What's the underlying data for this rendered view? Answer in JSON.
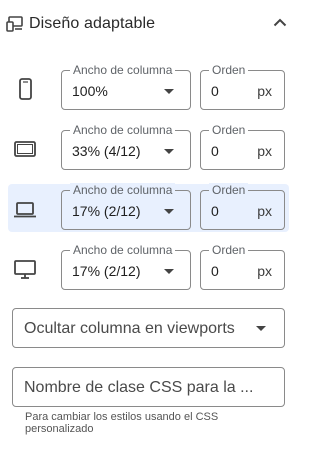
{
  "section": {
    "title": "Diseño adaptable",
    "icon": "responsive-devices-icon",
    "collapse_icon": "chevron-up-icon"
  },
  "rows": [
    {
      "device": "mobile",
      "icon": "mobile-icon",
      "column_label": "Ancho de columna",
      "column_value": "100%",
      "order_label": "Orden",
      "order_value": "0",
      "order_unit": "px",
      "active": false
    },
    {
      "device": "tablet",
      "icon": "tablet-icon",
      "column_label": "Ancho de columna",
      "column_value": "33% (4/12)",
      "order_label": "Orden",
      "order_value": "0",
      "order_unit": "px",
      "active": false
    },
    {
      "device": "laptop",
      "icon": "laptop-icon",
      "column_label": "Ancho de columna",
      "column_value": "17% (2/12)",
      "order_label": "Orden",
      "order_value": "0",
      "order_unit": "px",
      "active": true
    },
    {
      "device": "desktop",
      "icon": "desktop-icon",
      "column_label": "Ancho de columna",
      "column_value": "17% (2/12)",
      "order_label": "Orden",
      "order_value": "0",
      "order_unit": "px",
      "active": false
    }
  ],
  "hide_select": {
    "placeholder": "Ocultar columna en viewports"
  },
  "css_class": {
    "placeholder": "Nombre de clase CSS para la ...",
    "help": "Para cambiar los estilos usando el CSS personalizado"
  },
  "colors": {
    "active_row_bg": "#e8f0fe",
    "border": "#8a8a8a",
    "icon": "#444444"
  }
}
